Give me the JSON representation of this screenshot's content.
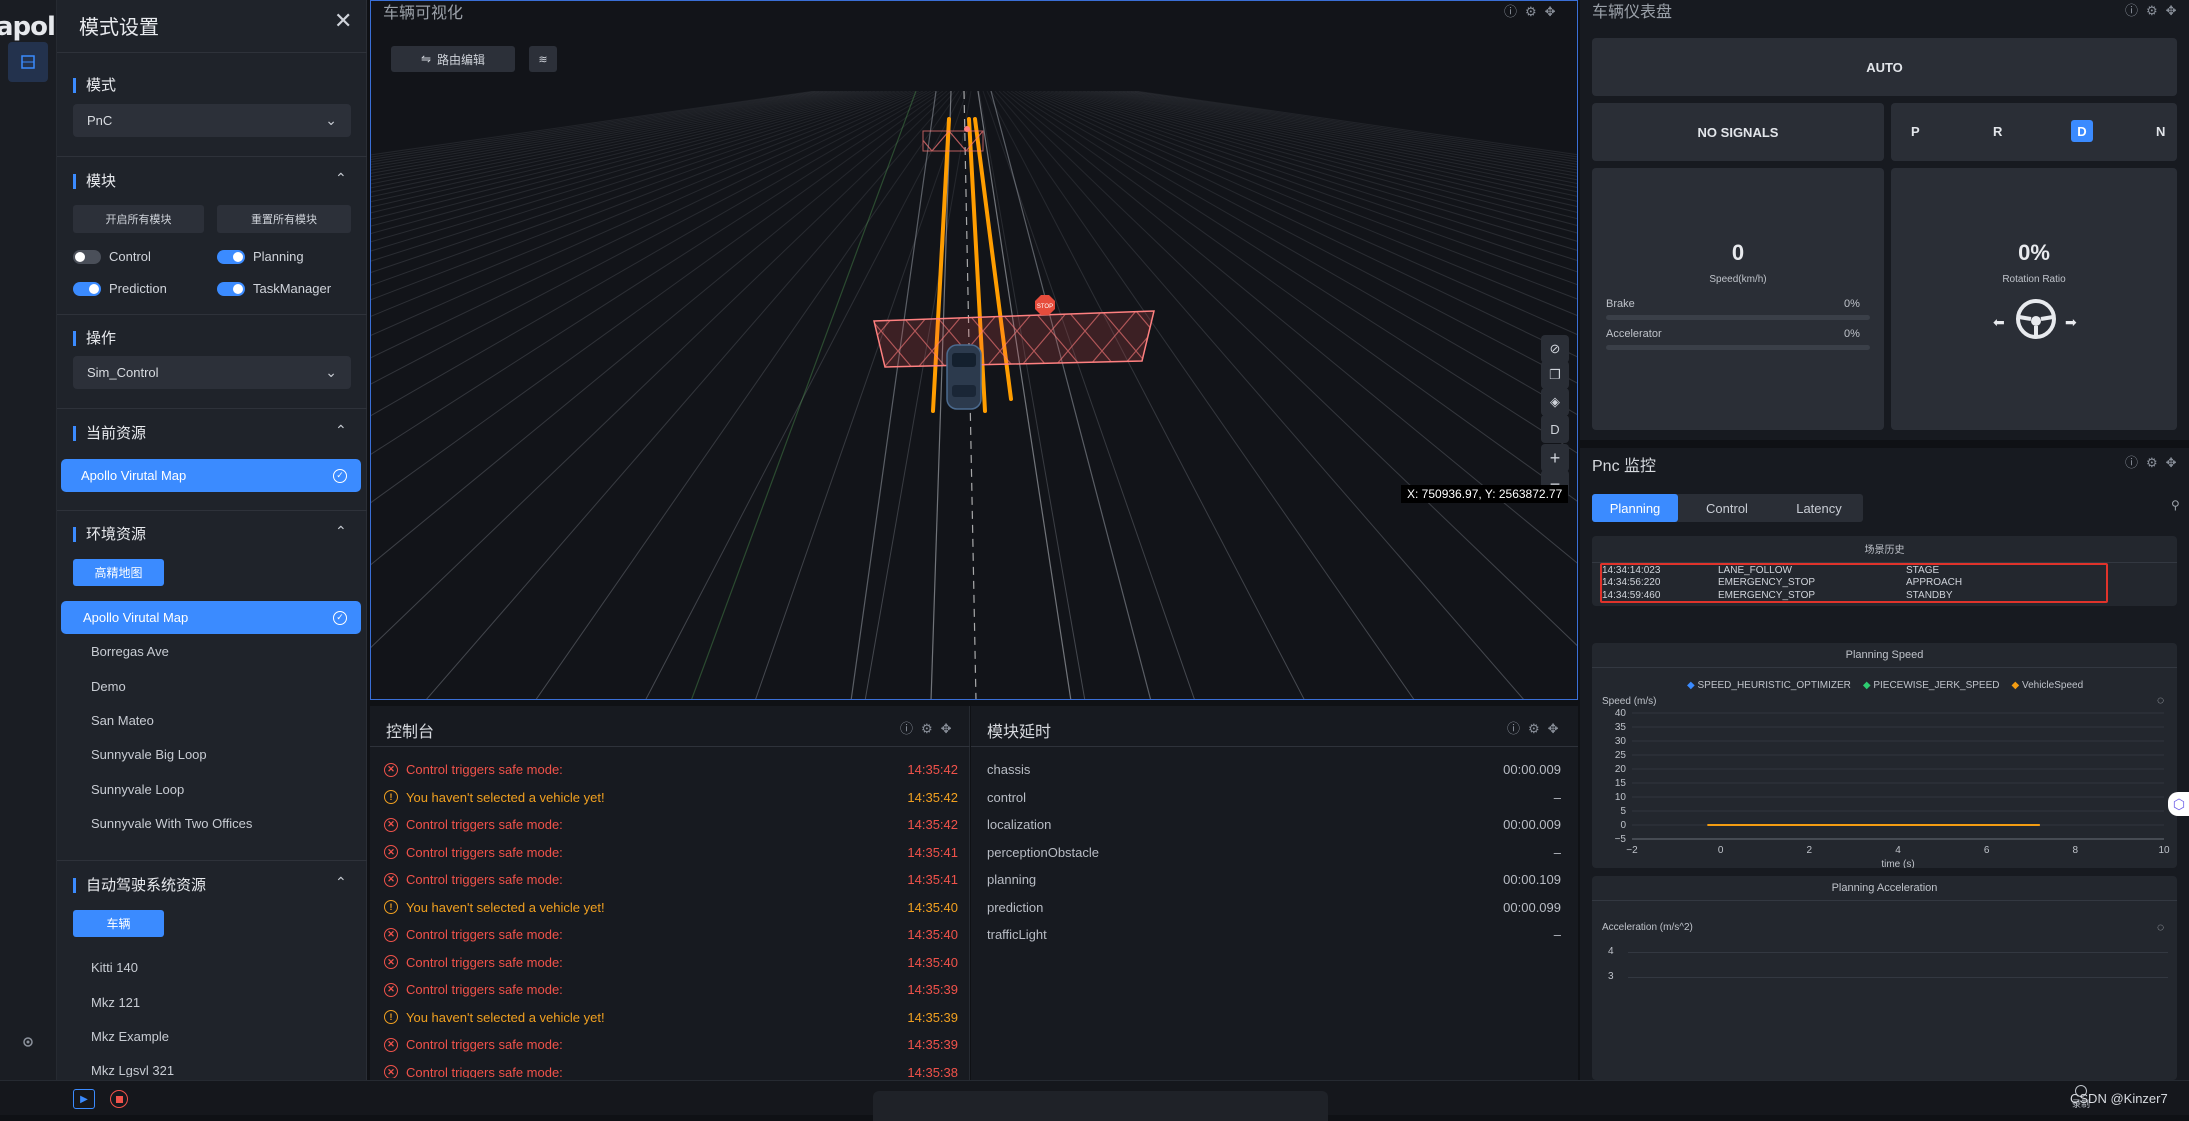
{
  "rail": {
    "logo": "apollo"
  },
  "panel": {
    "title": "模式设置",
    "mode": {
      "title": "模式",
      "value": "PnC"
    },
    "modules": {
      "title": "模块",
      "open_all": "开启所有模块",
      "reset_all": "重置所有模块",
      "items": [
        {
          "label": "Control",
          "on": false
        },
        {
          "label": "Planning",
          "on": true
        },
        {
          "label": "Prediction",
          "on": true
        },
        {
          "label": "TaskManager",
          "on": true
        }
      ]
    },
    "operation": {
      "title": "操作",
      "value": "Sim_Control"
    },
    "current_resource": {
      "title": "当前资源",
      "selected": "Apollo Virutal Map"
    },
    "env_resource": {
      "title": "环境资源",
      "tab": "高精地图",
      "maps": [
        "Apollo Virutal Map",
        "Borregas Ave",
        "Demo",
        "San Mateo",
        "Sunnyvale Big Loop",
        "Sunnyvale Loop",
        "Sunnyvale With Two Offices"
      ]
    },
    "ads_resource": {
      "title": "自动驾驶系统资源",
      "tab": "车辆",
      "vehicles": [
        "Kitti 140",
        "Mkz 121",
        "Mkz Example",
        "Mkz Lgsvl 321"
      ]
    }
  },
  "viewport": {
    "title": "车辆可视化",
    "route_edit": "路由编辑",
    "coords": "X: 750936.97, Y: 2563872.77",
    "stop_sign": "STOP",
    "tools": [
      "D",
      "+",
      "−"
    ]
  },
  "console": {
    "title": "控制台",
    "logs": [
      {
        "type": "err",
        "text": "Control triggers safe mode:",
        "time": "14:35:42"
      },
      {
        "type": "warn",
        "text": "You haven't selected a vehicle yet!",
        "time": "14:35:42"
      },
      {
        "type": "err",
        "text": "Control triggers safe mode:",
        "time": "14:35:42"
      },
      {
        "type": "err",
        "text": "Control triggers safe mode:",
        "time": "14:35:41"
      },
      {
        "type": "err",
        "text": "Control triggers safe mode:",
        "time": "14:35:41"
      },
      {
        "type": "warn",
        "text": "You haven't selected a vehicle yet!",
        "time": "14:35:40"
      },
      {
        "type": "err",
        "text": "Control triggers safe mode:",
        "time": "14:35:40"
      },
      {
        "type": "err",
        "text": "Control triggers safe mode:",
        "time": "14:35:40"
      },
      {
        "type": "err",
        "text": "Control triggers safe mode:",
        "time": "14:35:39"
      },
      {
        "type": "warn",
        "text": "You haven't selected a vehicle yet!",
        "time": "14:35:39"
      },
      {
        "type": "err",
        "text": "Control triggers safe mode:",
        "time": "14:35:39"
      },
      {
        "type": "err",
        "text": "Control triggers safe mode:",
        "time": "14:35:38"
      }
    ]
  },
  "latency": {
    "title": "模块延时",
    "rows": [
      {
        "name": "chassis",
        "value": "00:00.009"
      },
      {
        "name": "control",
        "value": "–"
      },
      {
        "name": "localization",
        "value": "00:00.009"
      },
      {
        "name": "perceptionObstacle",
        "value": "–"
      },
      {
        "name": "planning",
        "value": "00:00.109"
      },
      {
        "name": "prediction",
        "value": "00:00.099"
      },
      {
        "name": "trafficLight",
        "value": "–"
      }
    ]
  },
  "dashboard": {
    "title": "车辆仪表盘",
    "mode": "AUTO",
    "signals": "NO SIGNALS",
    "gears": [
      "P",
      "R",
      "D",
      "N"
    ],
    "active_gear": "D",
    "speed": "0",
    "speed_label": "Speed(km/h)",
    "brake_label": "Brake",
    "brake_value": "0%",
    "accel_label": "Accelerator",
    "accel_value": "0%",
    "rotation": "0%",
    "rotation_label": "Rotation Ratio"
  },
  "pnc": {
    "title": "Pnc 监控",
    "tabs": [
      "Planning",
      "Control",
      "Latency"
    ],
    "scenario": {
      "title": "场景历史",
      "rows": [
        {
          "time": "14:34:14:023",
          "scenario": "LANE_FOLLOW",
          "stage": "STAGE"
        },
        {
          "time": "14:34:56:220",
          "scenario": "EMERGENCY_STOP",
          "stage": "APPROACH"
        },
        {
          "time": "14:34:59:460",
          "scenario": "EMERGENCY_STOP",
          "stage": "STANDBY"
        }
      ]
    },
    "speed_chart": {
      "title": "Planning Speed",
      "ylabel": "Speed (m/s)",
      "xlabel": "time (s)"
    },
    "accel_chart": {
      "title": "Planning Acceleration",
      "ylabel": "Acceleration (m/s^2)",
      "ticks": [
        "4",
        "3"
      ]
    }
  },
  "chart_data": {
    "type": "line",
    "title": "Planning Speed",
    "xlabel": "time (s)",
    "ylabel": "Speed (m/s)",
    "xlim": [
      -2,
      10
    ],
    "ylim": [
      -5,
      40
    ],
    "x_ticks": [
      "−2",
      "0",
      "2",
      "4",
      "6",
      "8",
      "10"
    ],
    "y_ticks": [
      "40",
      "35",
      "30",
      "25",
      "20",
      "15",
      "10",
      "5",
      "0",
      "−5"
    ],
    "legend": [
      "SPEED_HEURISTIC_OPTIMIZER",
      "PIECEWISE_JERK_SPEED",
      "VehicleSpeed"
    ],
    "legend_colors": [
      "#3b8bff",
      "#2ecc71",
      "#f39c12"
    ],
    "series": [
      {
        "name": "VehicleSpeed",
        "x": [
          -0.3,
          7.2
        ],
        "y": [
          0,
          0
        ]
      }
    ]
  },
  "bottom": {
    "watermark": "CSDN @Kinzer7",
    "record": "录制"
  },
  "colors": {
    "accent": "#3b8bff",
    "error": "#f0524a",
    "warn": "#f0a020",
    "path": "#ff9d00"
  }
}
